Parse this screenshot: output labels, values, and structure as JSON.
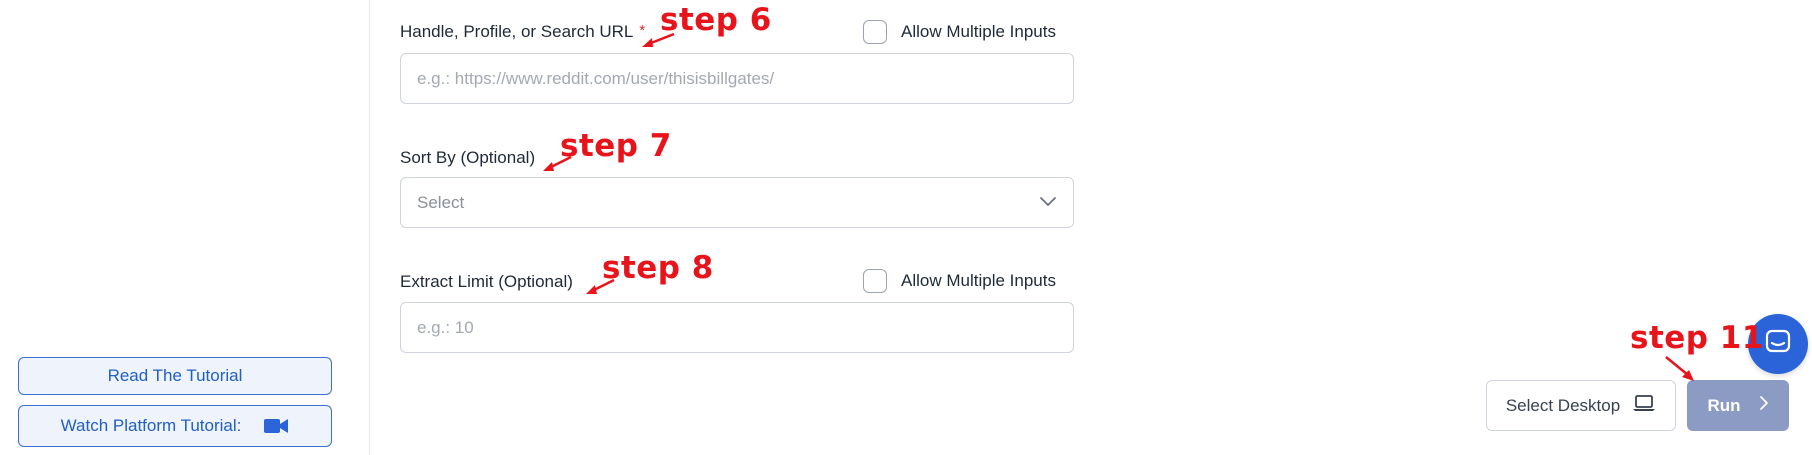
{
  "sidebar": {
    "read_tutorial_label": "Read The Tutorial",
    "watch_tutorial_label": "Watch Platform Tutorial:"
  },
  "form": {
    "url_field": {
      "label": "Handle, Profile, or Search URL",
      "required_mark": "*",
      "placeholder": "e.g.: https://www.reddit.com/user/thisisbillgates/",
      "value": "",
      "allow_multiple_label": "Allow Multiple Inputs",
      "allow_multiple_checked": false
    },
    "sort_by": {
      "label": "Sort By (Optional)",
      "selected": "Select"
    },
    "extract_limit": {
      "label": "Extract Limit (Optional)",
      "placeholder": "e.g.: 10",
      "value": "",
      "allow_multiple_label": "Allow Multiple Inputs",
      "allow_multiple_checked": false
    }
  },
  "actions": {
    "select_desktop_label": "Select Desktop",
    "run_label": "Run"
  },
  "annotations": {
    "step6": "step 6",
    "step7": "step 7",
    "step8": "step 8",
    "step11": "step 11"
  },
  "colors": {
    "accent": "#2b63d9",
    "annotation_red": "#e8141b",
    "run_button": "#8c9bc4"
  },
  "icons": {
    "video": "video-camera-icon",
    "laptop": "laptop-icon",
    "chevron_down": "chevron-down-icon",
    "chevron_right": "chevron-right-icon",
    "chat": "chat-icon"
  }
}
